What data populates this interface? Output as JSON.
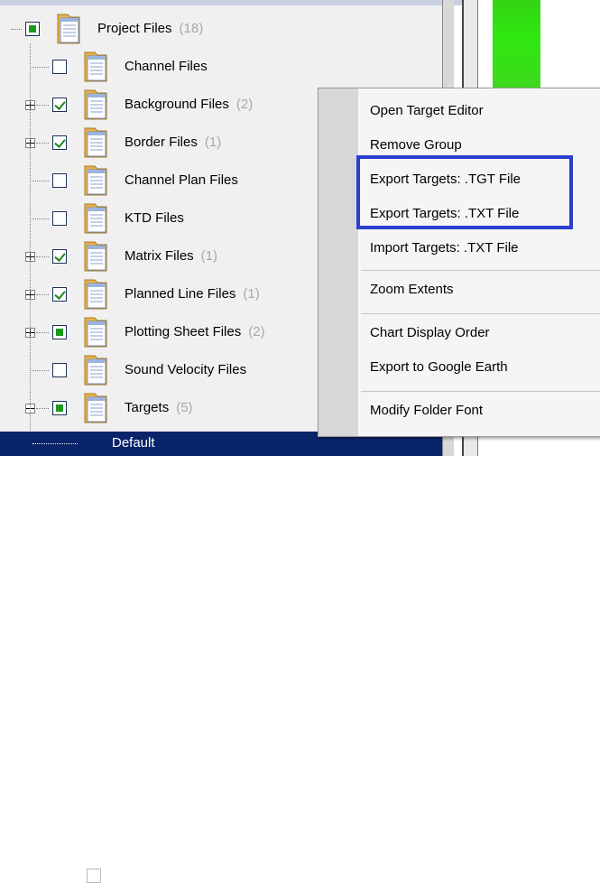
{
  "tree": {
    "items": [
      {
        "label": "Project Files",
        "count": "(18)",
        "check": "partial",
        "expander": "none"
      },
      {
        "label": "Channel Files",
        "count": "",
        "check": "unchecked",
        "expander": "none"
      },
      {
        "label": "Background Files",
        "count": "(2)",
        "check": "checked",
        "expander": "plus"
      },
      {
        "label": "Border Files",
        "count": "(1)",
        "check": "checked",
        "expander": "plus"
      },
      {
        "label": "Channel Plan Files",
        "count": "",
        "check": "unchecked",
        "expander": "none"
      },
      {
        "label": "KTD Files",
        "count": "",
        "check": "unchecked",
        "expander": "none"
      },
      {
        "label": "Matrix Files",
        "count": "(1)",
        "check": "checked",
        "expander": "plus"
      },
      {
        "label": "Planned Line Files",
        "count": "(1)",
        "check": "checked",
        "expander": "plus"
      },
      {
        "label": "Plotting Sheet Files",
        "count": "(2)",
        "check": "partial",
        "expander": "plus"
      },
      {
        "label": "Sound Velocity Files",
        "count": "",
        "check": "unchecked",
        "expander": "none"
      },
      {
        "label": "Targets",
        "count": "(5)",
        "check": "partial",
        "expander": "minus"
      }
    ],
    "selected_child": {
      "label": "Default"
    }
  },
  "context_menu": {
    "items": [
      {
        "label": "Open Target Editor"
      },
      {
        "label": "Remove Group"
      },
      {
        "label": "Export Targets: .TGT File"
      },
      {
        "label": "Export Targets: .TXT File"
      },
      {
        "label": "Import Targets: .TXT File"
      },
      {
        "label": "Zoom Extents"
      },
      {
        "label": "Chart Display Order"
      },
      {
        "label": "Export to Google Earth"
      },
      {
        "label": "Modify Folder Font"
      }
    ]
  },
  "colors": {
    "highlight_box": "#2b3fcf",
    "selection": "#0a246a",
    "check_green": "#1a8a1a",
    "green_bar": "#2ee80f"
  }
}
